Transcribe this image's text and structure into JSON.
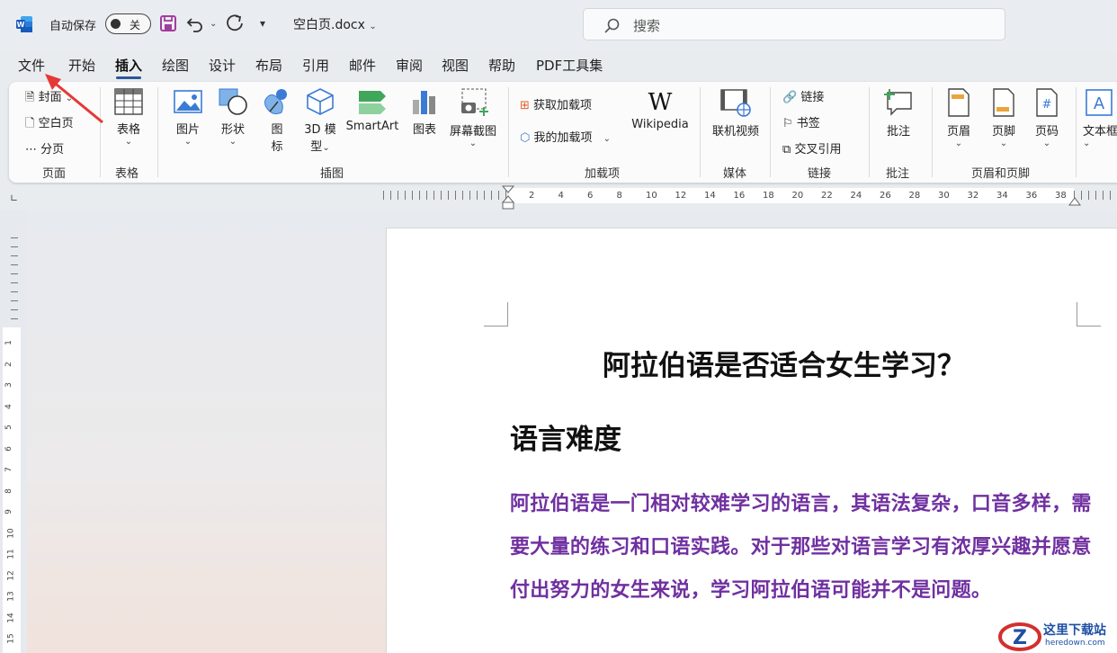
{
  "titlebar": {
    "app_icon": "word-logo",
    "autosave_label": "自动保存",
    "autosave_state": "关",
    "doc_title": "空白页.docx",
    "search_placeholder": "搜索"
  },
  "menu_tabs": [
    "文件",
    "开始",
    "插入",
    "绘图",
    "设计",
    "布局",
    "引用",
    "邮件",
    "审阅",
    "视图",
    "帮助",
    "PDF工具集"
  ],
  "active_tab": "插入",
  "ribbon": {
    "pages_group": {
      "label": "页面",
      "items": [
        "封面",
        "空白页",
        "分页"
      ]
    },
    "table_group": {
      "label": "表格",
      "items": [
        "表格"
      ]
    },
    "illustrations_group": {
      "label": "插图",
      "items": [
        "图片",
        "形状",
        "图标",
        "3D 模型",
        "SmartArt",
        "图表",
        "屏幕截图"
      ],
      "icon_line1": "图",
      "icon_line2": "标",
      "model_line1": "3D 模",
      "model_line2": "型"
    },
    "addins_group": {
      "label": "加载项",
      "items": [
        "获取加载项",
        "我的加载项",
        "Wikipedia"
      ]
    },
    "media_group": {
      "label": "媒体",
      "items": [
        "联机视频"
      ]
    },
    "links_group": {
      "label": "链接",
      "items": [
        "链接",
        "书签",
        "交叉引用"
      ]
    },
    "comments_group": {
      "label": "批注",
      "items": [
        "批注"
      ]
    },
    "header_footer_group": {
      "label": "页眉和页脚",
      "items": [
        "页眉",
        "页脚",
        "页码"
      ]
    },
    "text_group": {
      "items": [
        "文本框"
      ],
      "partial_label": "文本框"
    }
  },
  "ruler": {
    "h_numbers": [
      "2",
      "4",
      "6",
      "8",
      "10",
      "12",
      "14",
      "16",
      "18",
      "20",
      "22",
      "24",
      "26",
      "28",
      "30",
      "32",
      "34",
      "36",
      "38"
    ],
    "v_numbers": [
      "1",
      "2",
      "3",
      "4",
      "5",
      "6",
      "7",
      "8",
      "9",
      "10",
      "11",
      "12",
      "13",
      "14",
      "15"
    ]
  },
  "document": {
    "title": "阿拉伯语是否适合女生学习？",
    "heading": "语言难度",
    "paragraph": "阿拉伯语是一门相对较难学习的语言，其语法复杂，口音多样，需要大量的练习和口语实践。对于那些对语言学习有浓厚兴趣并愿意付出努力的女生来说，学习阿拉伯语可能并不是问题。",
    "paragraph_color": "#7030a0"
  },
  "colors": {
    "accent": "#2b579a",
    "save_icon": "#a23c9e",
    "arrow": "#e53935"
  },
  "watermark": {
    "title": "这里下载站",
    "url": "heredown.com"
  }
}
